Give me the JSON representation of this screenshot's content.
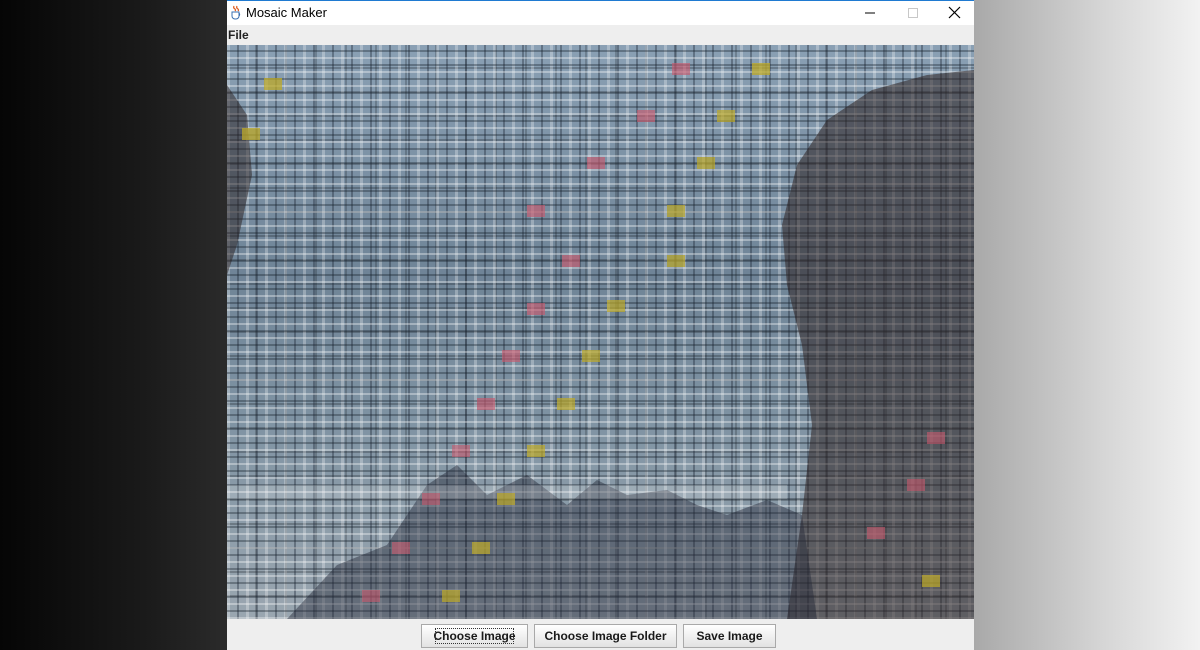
{
  "window": {
    "title": "Mosaic Maker",
    "icon": "java-cup-icon"
  },
  "titlebar_buttons": {
    "minimize": "minimize-icon",
    "maximize": "maximize-icon",
    "close": "close-icon"
  },
  "menubar": {
    "items": [
      {
        "label": "File"
      }
    ]
  },
  "canvas": {
    "description_tiles": "photo-mosaic"
  },
  "buttons": {
    "choose_image": "Choose Image",
    "choose_image_folder": "Choose Image Folder",
    "save_image": "Save Image"
  },
  "colors": {
    "title_accent": "#1f7ad1",
    "menubar_bg": "#eeeeee",
    "button_border": "#a9a9a9"
  }
}
